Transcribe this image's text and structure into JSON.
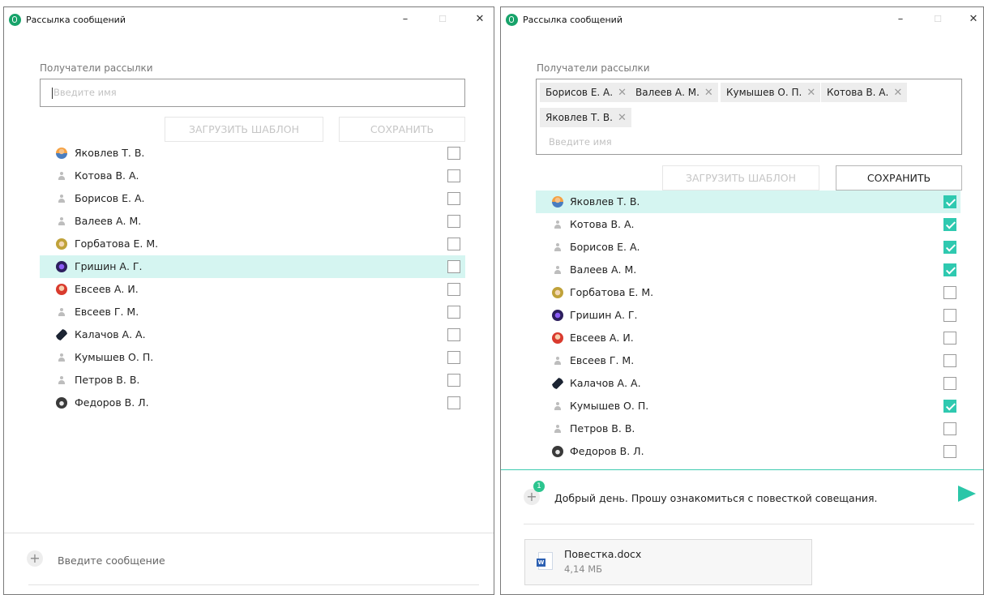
{
  "left_window": {
    "title": "Рассылка сообщений",
    "controls": {
      "minimize": "–",
      "maximize": "☐",
      "close": "✕"
    },
    "recipients_label": "Получатели рассылки",
    "search_placeholder": "Введите имя",
    "load_template_label": "ЗАГРУЗИТЬ ШАБЛОН",
    "save_label": "СОХРАНИТЬ",
    "contacts": [
      {
        "name": "Яковлев Т. В.",
        "avatar": "orange-person-avatar",
        "checked": false,
        "highlighted": false
      },
      {
        "name": "Котова В. А.",
        "avatar": "default-person-avatar",
        "checked": false,
        "highlighted": false
      },
      {
        "name": "Борисов Е. А.",
        "avatar": "default-person-avatar",
        "checked": false,
        "highlighted": false
      },
      {
        "name": "Валеев А. М.",
        "avatar": "default-person-avatar",
        "checked": false,
        "highlighted": false
      },
      {
        "name": "Горбатова Е. М.",
        "avatar": "olive-person-avatar",
        "checked": false,
        "highlighted": false
      },
      {
        "name": "Гришин А. Г.",
        "avatar": "purple-avatar",
        "checked": false,
        "highlighted": true
      },
      {
        "name": "Евсеев А. И.",
        "avatar": "red-person-avatar",
        "checked": false,
        "highlighted": false
      },
      {
        "name": "Евсеев Г. М.",
        "avatar": "default-person-avatar",
        "checked": false,
        "highlighted": false
      },
      {
        "name": "Калачов А. А.",
        "avatar": "dark-animal-avatar",
        "checked": false,
        "highlighted": false
      },
      {
        "name": "Кумышев О. П.",
        "avatar": "default-person-avatar",
        "checked": false,
        "highlighted": false
      },
      {
        "name": "Петров В. В.",
        "avatar": "default-person-avatar",
        "checked": false,
        "highlighted": false
      },
      {
        "name": "Федоров В. Л.",
        "avatar": "bear-avatar",
        "checked": false,
        "highlighted": false
      }
    ],
    "message_placeholder": "Введите сообщение"
  },
  "right_window": {
    "title": "Рассылка сообщений",
    "controls": {
      "minimize": "–",
      "maximize": "☐",
      "close": "✕"
    },
    "recipients_label": "Получатели рассылки",
    "chips": [
      "Борисов Е. А.",
      "Валеев А. М.",
      "Кумышев О. П.",
      "Котова В. А.",
      "Яковлев Т. В."
    ],
    "chip_remove_glyph": "✕",
    "search_placeholder": "Введите имя",
    "load_template_label": "ЗАГРУЗИТЬ ШАБЛОН",
    "save_label": "СОХРАНИТЬ",
    "contacts": [
      {
        "name": "Яковлев Т. В.",
        "avatar": "orange-person-avatar",
        "checked": true,
        "highlighted": true
      },
      {
        "name": "Котова В. А.",
        "avatar": "default-person-avatar",
        "checked": true,
        "highlighted": false
      },
      {
        "name": "Борисов Е. А.",
        "avatar": "default-person-avatar",
        "checked": true,
        "highlighted": false
      },
      {
        "name": "Валеев А. М.",
        "avatar": "default-person-avatar",
        "checked": true,
        "highlighted": false
      },
      {
        "name": "Горбатова Е. М.",
        "avatar": "olive-person-avatar",
        "checked": false,
        "highlighted": false
      },
      {
        "name": "Гришин А. Г.",
        "avatar": "purple-avatar",
        "checked": false,
        "highlighted": false
      },
      {
        "name": "Евсеев А. И.",
        "avatar": "red-person-avatar",
        "checked": false,
        "highlighted": false
      },
      {
        "name": "Евсеев Г. М.",
        "avatar": "default-person-avatar",
        "checked": false,
        "highlighted": false
      },
      {
        "name": "Калачов А. А.",
        "avatar": "dark-animal-avatar",
        "checked": false,
        "highlighted": false
      },
      {
        "name": "Кумышев О. П.",
        "avatar": "default-person-avatar",
        "checked": true,
        "highlighted": false
      },
      {
        "name": "Петров В. В.",
        "avatar": "default-person-avatar",
        "checked": false,
        "highlighted": false
      },
      {
        "name": "Федоров В. Л.",
        "avatar": "bear-avatar",
        "checked": false,
        "highlighted": false
      }
    ],
    "attach_badge": "1",
    "message_text": "Добрый день. Прошу ознакомиться с повесткой совещания.",
    "attachment": {
      "filename": "Повестка.docx",
      "size": "4,14 МБ",
      "icon_letter": "W"
    }
  },
  "colors": {
    "accent": "#2fc9b0",
    "highlight_row": "#d5f5f1",
    "send": "#2bc6a8",
    "badge": "#2cc58f"
  }
}
